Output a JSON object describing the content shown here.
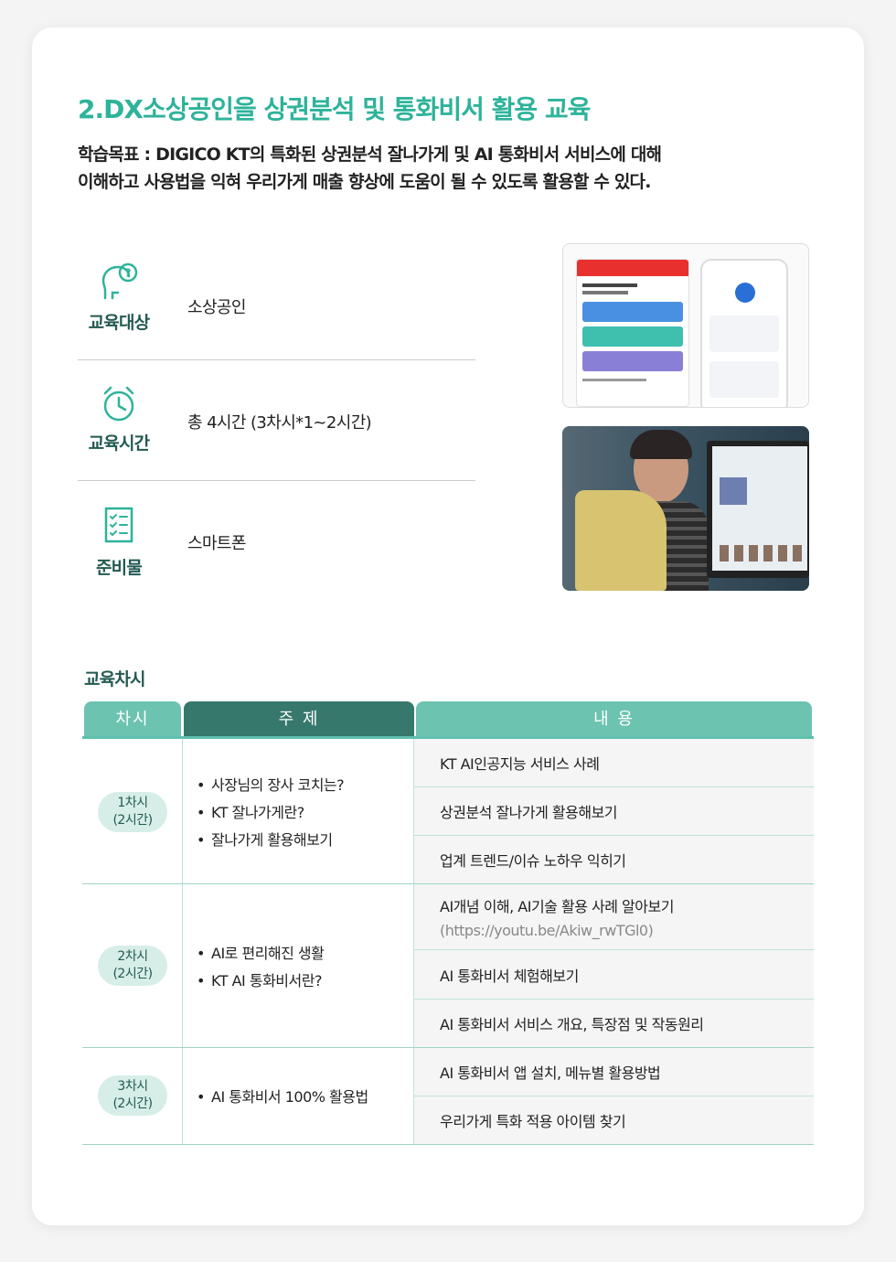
{
  "title": "2.DX소상공인을 상권분석 및 통화비서 활용 교육",
  "goal": {
    "line1": "학습목표 : DIGICO KT의 특화된 상권분석 잘나가게 및 AI 통화비서 서비스에 대해",
    "line2": "이해하고 사용법을 익혀 우리가게  매출 향상에 도움이 될 수 있도록 활용할 수 있다."
  },
  "info": [
    {
      "label": "교육대상",
      "value": "소상공인",
      "icon": "head-question-icon"
    },
    {
      "label": "교육시간",
      "value": "총 4시간 (3차시*1~2시간)",
      "icon": "alarm-clock-icon"
    },
    {
      "label": "준비물",
      "value": "스마트폰",
      "icon": "checklist-icon"
    }
  ],
  "colors": {
    "accent": "#2eb39a",
    "dark_green": "#235a52",
    "header_light": "#6cc3b0",
    "header_dark": "#36786b"
  },
  "sessions_label": "교육차시",
  "table": {
    "headers": [
      "차시",
      "주 제",
      "내 용"
    ],
    "rows": [
      {
        "session_line1": "1차시",
        "session_line2": "(2시간)",
        "topics": [
          "사장님의 장사 코치는?",
          "KT 잘나가게란?",
          "잘나가게 활용해보기"
        ],
        "contents": [
          "KT AI인공지능 서비스 사례",
          "상권분석 잘나가게 활용해보기",
          "업계 트렌드/이슈 노하우 익히기"
        ]
      },
      {
        "session_line1": "2차시",
        "session_line2": "(2시간)",
        "topics": [
          "AI로 편리해진 생활",
          "KT AI 통화비서란?"
        ],
        "contents": [
          "AI개념 이해, AI기술 활용 사례 알아보기",
          "AI 통화비서 체험해보기",
          "AI 통화비서 서비스 개요, 특장점 및 작동원리"
        ],
        "content_url": "(https://youtu.be/Akiw_rwTGl0)"
      },
      {
        "session_line1": "3차시",
        "session_line2": "(2시간)",
        "topics": [
          "AI 통화비서 100% 활용법"
        ],
        "contents": [
          "AI 통화비서 앱 설치, 메뉴별 활용방법",
          "우리가게 특화 적용 아이템 찾기"
        ]
      }
    ]
  }
}
